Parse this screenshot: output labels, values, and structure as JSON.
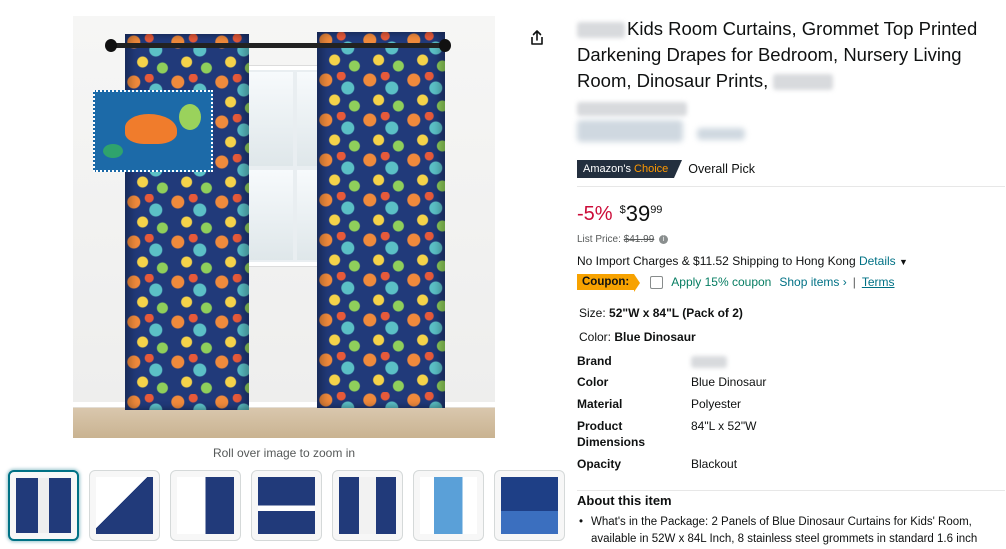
{
  "product": {
    "title": "Kids Room Curtains, Grommet Top Printed Darkening Drapes for Bedroom, Nursery Living Room, Dinosaur Prints,",
    "badge_prefix": "Amazon's",
    "badge_choice": "Choice",
    "badge_label": "Overall Pick"
  },
  "image": {
    "zoom_hint": "Roll over image to zoom in"
  },
  "thumbnails": [
    {
      "name": "thumb-1",
      "selected": true
    },
    {
      "name": "thumb-2",
      "selected": false
    },
    {
      "name": "thumb-3",
      "selected": false
    },
    {
      "name": "thumb-4",
      "selected": false
    },
    {
      "name": "thumb-5",
      "selected": false
    },
    {
      "name": "thumb-6",
      "selected": false
    },
    {
      "name": "thumb-7",
      "selected": false
    }
  ],
  "price": {
    "discount": "-5%",
    "currency": "$",
    "whole": "39",
    "fraction": "99",
    "list_label": "List Price:",
    "list_value": "$41.99"
  },
  "shipping": {
    "text": "No Import Charges & $11.52 Shipping to Hong Kong",
    "details": "Details"
  },
  "coupon": {
    "badge": "Coupon:",
    "text": "Apply 15% coupon",
    "shop_items": "Shop items ›",
    "separator": "|",
    "terms": "Terms"
  },
  "variants": {
    "size_label": "Size:",
    "size_value": "52\"W x 84\"L (Pack of 2)",
    "color_label": "Color:",
    "color_value": "Blue Dinosaur"
  },
  "specs": [
    {
      "label": "Brand",
      "value": ""
    },
    {
      "label": "Color",
      "value": "Blue Dinosaur"
    },
    {
      "label": "Material",
      "value": "Polyester"
    },
    {
      "label": "Product Dimensions",
      "value": "84\"L x 52\"W"
    },
    {
      "label": "Opacity",
      "value": "Blackout"
    }
  ],
  "about": {
    "title": "About this item",
    "bullet_1": "What's in the Package: 2 Panels of Blue Dinosaur Curtains for Kids' Room, available in 52W x 84L Inch, 8 stainless steel grommets in standard 1.6 inch"
  },
  "icons": {
    "share": "share-icon",
    "info": "info-icon",
    "chevron": "chevron-down-icon"
  },
  "colors": {
    "link": "#007185",
    "discount": "#cc0c39",
    "coupon_badge": "#f7a200",
    "coupon_text": "#067d62",
    "badge_bg": "#232f3e",
    "badge_accent": "#ff9900"
  }
}
